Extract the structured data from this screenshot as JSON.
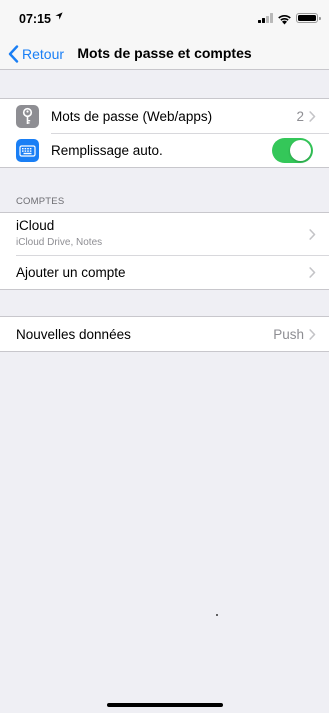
{
  "status_bar": {
    "time": "07:15"
  },
  "nav": {
    "back_label": "Retour",
    "title": "Mots de passe et comptes"
  },
  "passwords_group": {
    "passwords_label": "Mots de passe (Web/apps)",
    "passwords_count": "2",
    "autofill_label": "Remplissage auto.",
    "autofill_enabled": true
  },
  "accounts_section": {
    "header": "COMPTES",
    "items": [
      {
        "label": "iCloud",
        "sublabel": "iCloud Drive, Notes"
      },
      {
        "label": "Ajouter un compte"
      }
    ]
  },
  "fetch_group": {
    "label": "Nouvelles données",
    "value": "Push"
  },
  "colors": {
    "accent": "#1a7ff5",
    "toggle_on": "#34c759",
    "background": "#efeff4",
    "secondary_text": "#8e8e93"
  }
}
